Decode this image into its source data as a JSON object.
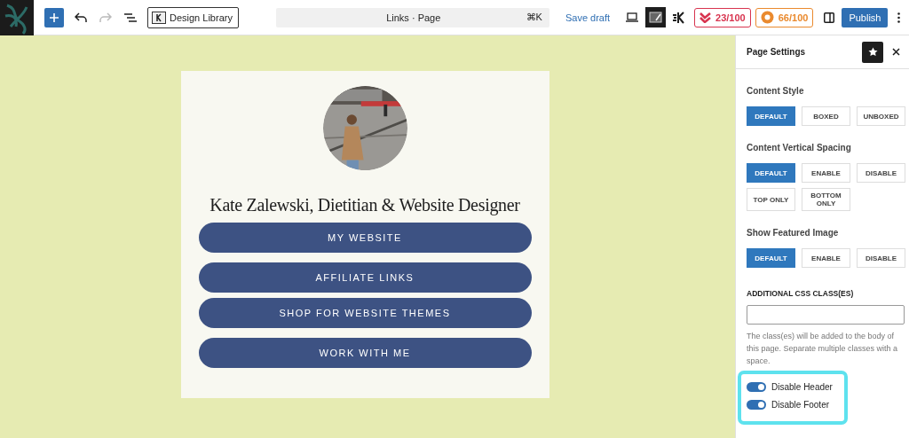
{
  "toolbar": {
    "library_button": "Design Library",
    "command_bar": {
      "title": "Links · Page",
      "shortcut": "⌘K"
    },
    "save_draft": "Save draft",
    "scores": [
      {
        "value": "23/100",
        "color": "#d8344f"
      },
      {
        "value": "66/100",
        "color": "#ea8a2e"
      }
    ],
    "publish": "Publish"
  },
  "canvas": {
    "title": "Kate Zalewski, Dietitian & Website Designer",
    "links": [
      {
        "label": "MY WEBSITE"
      },
      {
        "label": "AFFILIATE LINKS"
      },
      {
        "label": "SHOP FOR WEBSITE THEMES"
      },
      {
        "label": "WORK WITH ME"
      }
    ]
  },
  "sidebar": {
    "title": "Page Settings",
    "groups": [
      {
        "label": "Content Style",
        "options": [
          {
            "label": "DEFAULT",
            "selected": true
          },
          {
            "label": "BOXED",
            "selected": false
          },
          {
            "label": "UNBOXED",
            "selected": false
          }
        ]
      },
      {
        "label": "Content Vertical Spacing",
        "options": [
          {
            "label": "DEFAULT",
            "selected": true
          },
          {
            "label": "ENABLE",
            "selected": false
          },
          {
            "label": "DISABLE",
            "selected": false
          },
          {
            "label": "TOP ONLY",
            "selected": false
          },
          {
            "label": "BOTTOM ONLY",
            "selected": false
          }
        ]
      },
      {
        "label": "Show Featured Image",
        "options": [
          {
            "label": "DEFAULT",
            "selected": true
          },
          {
            "label": "ENABLE",
            "selected": false
          },
          {
            "label": "DISABLE",
            "selected": false
          }
        ]
      }
    ],
    "css_field": {
      "label": "ADDITIONAL CSS CLASS(ES)"
    },
    "help": "The class(es) will be added to the body of this page. Separate multiple classes with a space.",
    "toggles": [
      {
        "label": "Disable Header",
        "on": true
      },
      {
        "label": "Disable Footer",
        "on": true
      }
    ]
  }
}
